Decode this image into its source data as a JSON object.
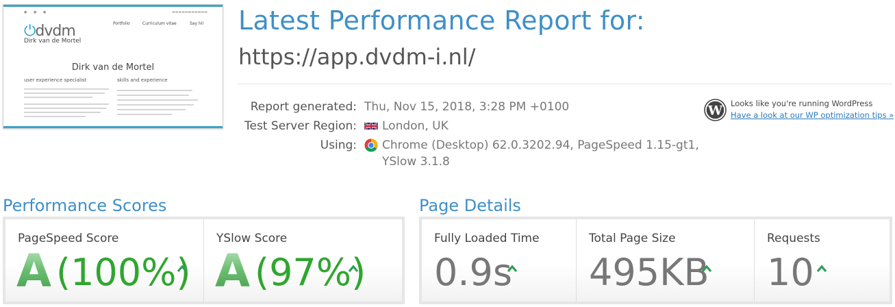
{
  "header": {
    "title": "Latest Performance Report for:",
    "url": "https://app.dvdm-i.nl/"
  },
  "thumbnail": {
    "site_logo_mark": "dvdm",
    "site_name": "Dirk van de Mortel",
    "nav": [
      "Portfolio",
      "Curriculum vitae",
      "Say hi!"
    ],
    "heading": "Dirk van de Mortel",
    "col_left": "user experience specialist",
    "col_right": "skills and experience"
  },
  "meta": {
    "report_generated_label": "Report generated:",
    "report_generated_value": "Thu, Nov 15, 2018, 3:28 PM +0100",
    "region_label": "Test Server Region:",
    "region_value": "London, UK",
    "using_label": "Using:",
    "using_value_line1": "Chrome (Desktop) 62.0.3202.94, PageSpeed 1.15-gt1,",
    "using_value_line2": "YSlow 3.1.8"
  },
  "wordpress": {
    "note": "Looks like you're running WordPress",
    "link": "Have a look at our WP optimization tips »"
  },
  "performance": {
    "title": "Performance Scores",
    "pagespeed": {
      "label": "PageSpeed Score",
      "grade": "A",
      "percent": "(100%)"
    },
    "yslow": {
      "label": "YSlow Score",
      "grade": "A",
      "percent": "(97%)"
    }
  },
  "details": {
    "title": "Page Details",
    "load_time": {
      "label": "Fully Loaded Time",
      "value": "0.9s"
    },
    "page_size": {
      "label": "Total Page Size",
      "value": "495KB"
    },
    "requests": {
      "label": "Requests",
      "value": "10"
    }
  },
  "colors": {
    "accent_blue": "#3f8fc7",
    "grade_green": "#2fa62f",
    "arrow_green": "#2e9e57"
  }
}
